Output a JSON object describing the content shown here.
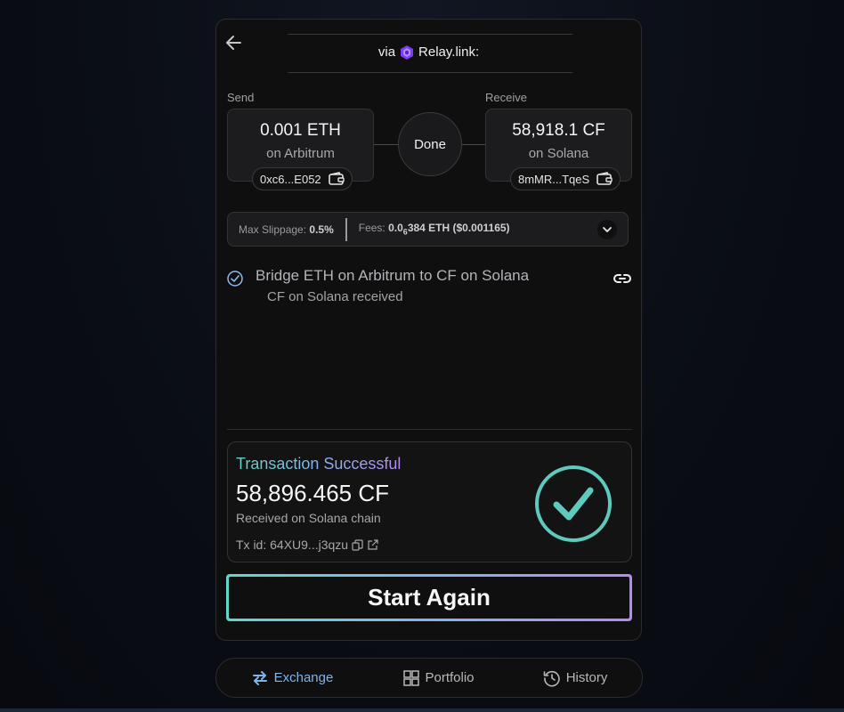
{
  "header": {
    "via_label": "via",
    "provider": "Relay.link:"
  },
  "send": {
    "label": "Send",
    "amount": "0.001 ETH",
    "chain": "on Arbitrum",
    "address": "0xc6...E052"
  },
  "status": {
    "label": "Done"
  },
  "receive": {
    "label": "Receive",
    "amount": "58,918.1 CF",
    "chain": "on Solana",
    "address": "8mMR...TqeS"
  },
  "fees": {
    "slippage_label": "Max Slippage:",
    "slippage_value": "0.5%",
    "fees_label": "Fees:",
    "fees_value_prefix": "0.0",
    "fees_value_sub": "6",
    "fees_value_suffix": "384 ETH ($0.001165)"
  },
  "step": {
    "title": "Bridge ETH on Arbitrum to CF on Solana",
    "subtitle": "CF on Solana received"
  },
  "success": {
    "title": "Transaction Successful",
    "amount": "58,896.465 CF",
    "subtitle": "Received on Solana chain",
    "txid_label": "Tx id: 64XU9...j3qzu"
  },
  "start_again": {
    "label": "Start Again"
  },
  "nav": {
    "items": [
      {
        "label": "Exchange",
        "icon": "swap-arrows-icon",
        "active": true
      },
      {
        "label": "Portfolio",
        "icon": "grid-icon",
        "active": false
      },
      {
        "label": "History",
        "icon": "history-clock-icon",
        "active": false
      }
    ]
  },
  "colors": {
    "accent_teal": "#5fd8c9",
    "accent_purple": "#b48bf0",
    "active_nav": "#7fb5e8"
  }
}
